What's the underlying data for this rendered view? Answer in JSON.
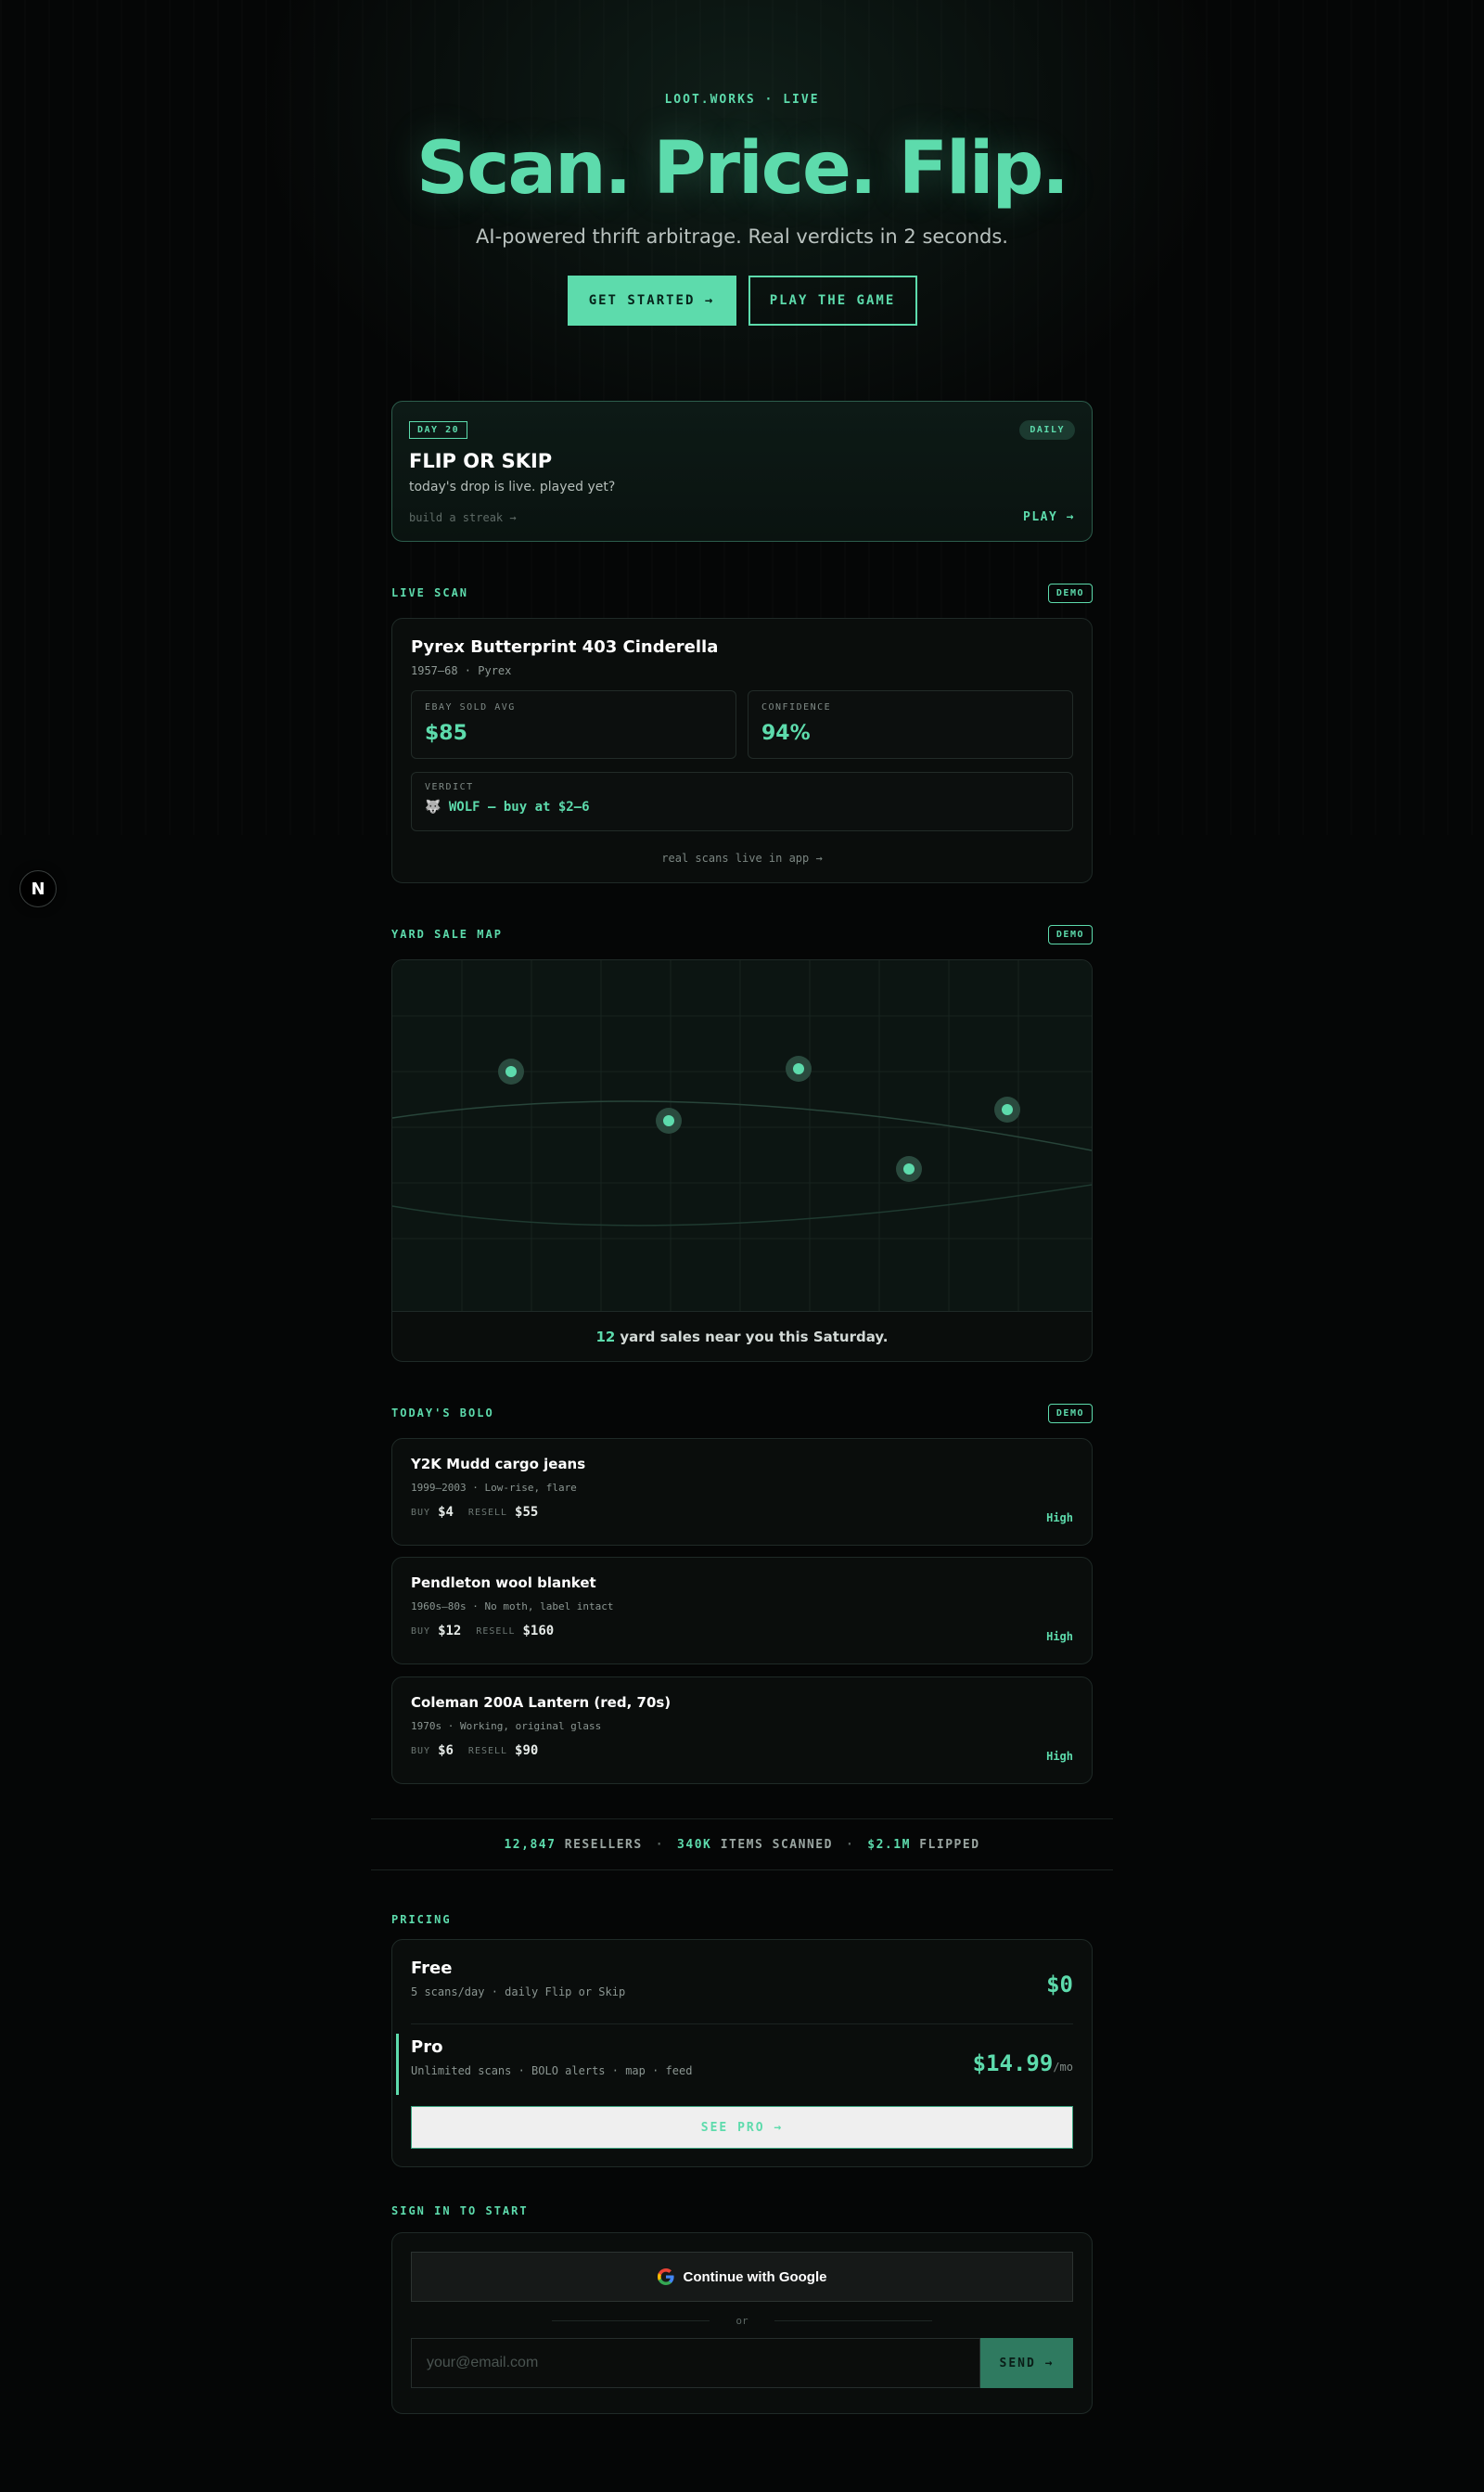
{
  "hero": {
    "eyebrow": "LOOT.WORKS · LIVE",
    "title": "Scan. Price. Flip.",
    "subtitle": "AI-powered thrift arbitrage. Real verdicts in 2 seconds.",
    "primary_cta": "GET STARTED →",
    "secondary_cta": "PLAY THE GAME"
  },
  "daily": {
    "day_badge": "DAY 20",
    "pill": "DAILY",
    "title": "FLIP OR SKIP",
    "subtitle": "today's drop is live. played yet?",
    "streak": "build a streak →",
    "play": "PLAY →"
  },
  "live_scan": {
    "label": "LIVE SCAN",
    "badge": "DEMO",
    "item_title": "Pyrex Butterprint 403 Cinderella",
    "item_meta": "1957–68 · Pyrex",
    "stats": [
      {
        "label": "EBAY SOLD AVG",
        "value": "$85"
      },
      {
        "label": "CONFIDENCE",
        "value": "94%"
      }
    ],
    "verdict_label": "VERDICT",
    "verdict_text": "🐺 WOLF — buy at $2–6",
    "footer": "real scans live in app →"
  },
  "map": {
    "label": "YARD SALE MAP",
    "badge": "DEMO",
    "count": "12",
    "caption": "yard sales near you this Saturday."
  },
  "bolo": {
    "label": "TODAY'S BOLO",
    "badge": "DEMO",
    "buy_label": "BUY",
    "resell_label": "RESELL",
    "items": [
      {
        "title": "Y2K Mudd cargo jeans",
        "meta": "1999–2003 · Low-rise, flare",
        "buy": "$4",
        "resell": "$55",
        "confidence": "High"
      },
      {
        "title": "Pendleton wool blanket",
        "meta": "1960s–80s · No moth, label intact",
        "buy": "$12",
        "resell": "$160",
        "confidence": "High"
      },
      {
        "title": "Coleman 200A Lantern (red, 70s)",
        "meta": "1970s · Working, original glass",
        "buy": "$6",
        "resell": "$90",
        "confidence": "High"
      }
    ]
  },
  "stats": {
    "resellers_num": "12,847",
    "resellers_label": "RESELLERS",
    "scanned_num": "340K",
    "scanned_label": "ITEMS SCANNED",
    "flipped_num": "$2.1M",
    "flipped_label": "FLIPPED",
    "separator": "·"
  },
  "pricing": {
    "label": "PRICING",
    "free": {
      "name": "Free",
      "desc": "5 scans/day · daily Flip or Skip",
      "price": "$0"
    },
    "pro": {
      "name": "Pro",
      "desc": "Unlimited scans · BOLO alerts · map · feed",
      "price": "$14.99",
      "per": "/mo"
    },
    "cta": "SEE PRO →"
  },
  "signin": {
    "label": "SIGN IN TO START",
    "google": "Continue with Google",
    "or": "or",
    "email_placeholder": "your@email.com",
    "send": "SEND →"
  },
  "floating_badge": "N",
  "colors": {
    "accent": "#5ddbac",
    "background": "#050606",
    "card": "#0a0d0c",
    "send_button": "#2f7a60"
  }
}
